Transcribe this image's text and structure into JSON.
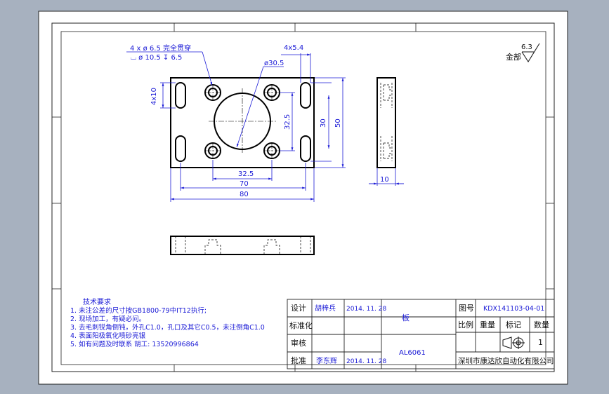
{
  "drawing": {
    "hole_callout": {
      "line1": "4 x ø 6.5 完全贯穿",
      "line2": "⌴ ø 10.5 ↧ 6.5"
    },
    "dimensions": {
      "slot_count_width": "4x5.4",
      "center_bore": "ø30.5",
      "slot_length": "4x10",
      "hole_spacing_v": "32.5",
      "slot_span_v": "30",
      "height": "50",
      "hole_spacing_h": "32.5",
      "slot_span_h": "70",
      "width": "80",
      "thickness": "10"
    },
    "roughness": {
      "prefix": "金部",
      "value": "6.3"
    }
  },
  "tech_requirements": {
    "title": "技术要求",
    "items": [
      "1. 未注公差的尺寸按GB1800-79中IT12执行;",
      "2. 现场加工，有疑必问。",
      "3. 去毛刺锐角倒钝，外孔C1.0，孔口及其它C0.5，未注倒角C1.0",
      "4. 表面阳极氧化喷砂亮银",
      "5. 如有问题及时联系  胡工: 13520996864"
    ]
  },
  "title_block": {
    "design_label": "设计",
    "designer": "胡梓兵",
    "design_date": "2014. 11. 28",
    "standard_label": "标准化",
    "review_label": "审核",
    "approve_label": "批准",
    "approver": "李东辉",
    "approve_date": "2014. 11. 28",
    "part_name": "板",
    "material": "AL6061",
    "drawing_no_label": "图号",
    "drawing_no": "KDX141103-04-01",
    "scale_label": "比例",
    "weight_label": "重量",
    "mark_label": "标记",
    "qty_label": "数量",
    "qty": "1",
    "company": "深圳市康达欣自动化有限公司"
  }
}
